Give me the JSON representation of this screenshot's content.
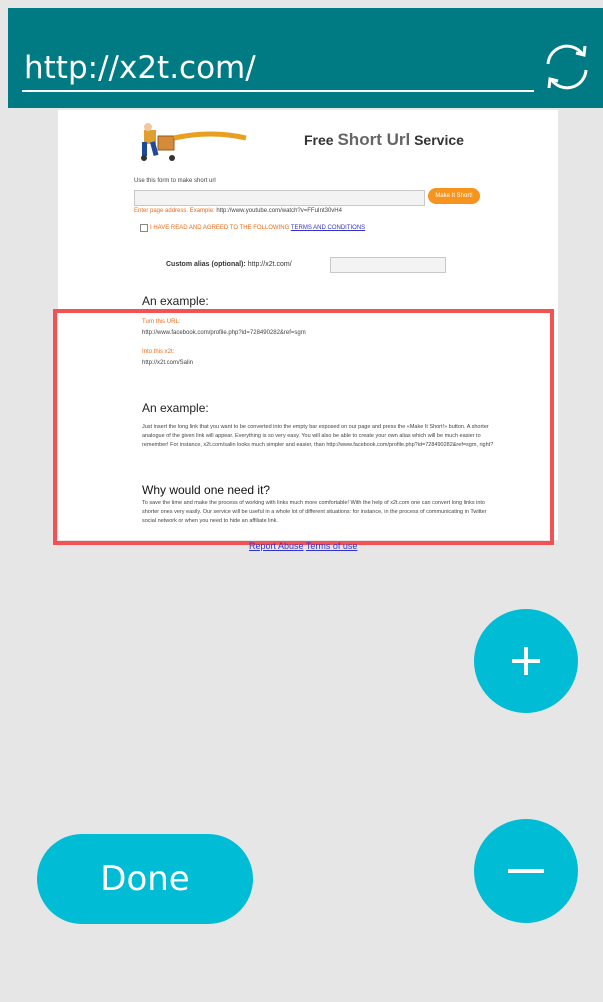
{
  "browser": {
    "url_value": "http://x2t.com/",
    "refresh_icon": "refresh-icon"
  },
  "page": {
    "title_prefix": "Free ",
    "title_highlight": "Short Url",
    "title_suffix": " Service",
    "form_caption": "Use this form to make short url",
    "make_short_label": "Make It Short!",
    "enter_address_label": "Enter page address. Example:",
    "enter_address_example": "http://www.youtube.com/watch?v=FFuInt30vH4",
    "agree_text": "I HAVE READ AND AGREED TO THE FOLLOWING",
    "terms_link": "TERMS AND CONDITIONS",
    "alias_label": "Custom alias (optional):",
    "alias_prefix": "http://x2t.com/",
    "example_heading_1": "An example:",
    "turn_label": "Turn this URL:",
    "turn_url": "http://www.facebook.com/profile.php?id=728490282&ref=sgm",
    "into_label": "Into this x2t:",
    "into_url": "http://x2t.com/Salin",
    "example_heading_2": "An example:",
    "example_para": "Just insert the long link that you want to be converted into the empty bar exposed on our page and press the «Make It Short!» button. A shorter analogue of the given link will appear. Everything is so very easy. You will also be able to create your own alias which will be much easier to remember! For instance, x2t.com/salin looks much simpler and easier, than http://www.facebook.com/profile.php?id=728490282&ref=sgm, right?",
    "why_heading": "Why would one need it?",
    "why_para": "To save the time and make the process of working with links much more comfortable! With the help of x2t.com one can convert long links into shorter ones very easily. Our service will be useful in a whole lot of different situations: for instance, in the process of communicating in Twitter social network or when you need to hide an affiliate link.",
    "report_abuse": "Report Abuse",
    "terms_of_use": "Terms of use"
  },
  "controls": {
    "done_label": "Done",
    "zoom_in_icon": "plus-icon",
    "zoom_out_icon": "minus-icon"
  },
  "colors": {
    "toolbar": "#007b83",
    "accent": "#00bcd4",
    "highlight": "#f35154"
  }
}
